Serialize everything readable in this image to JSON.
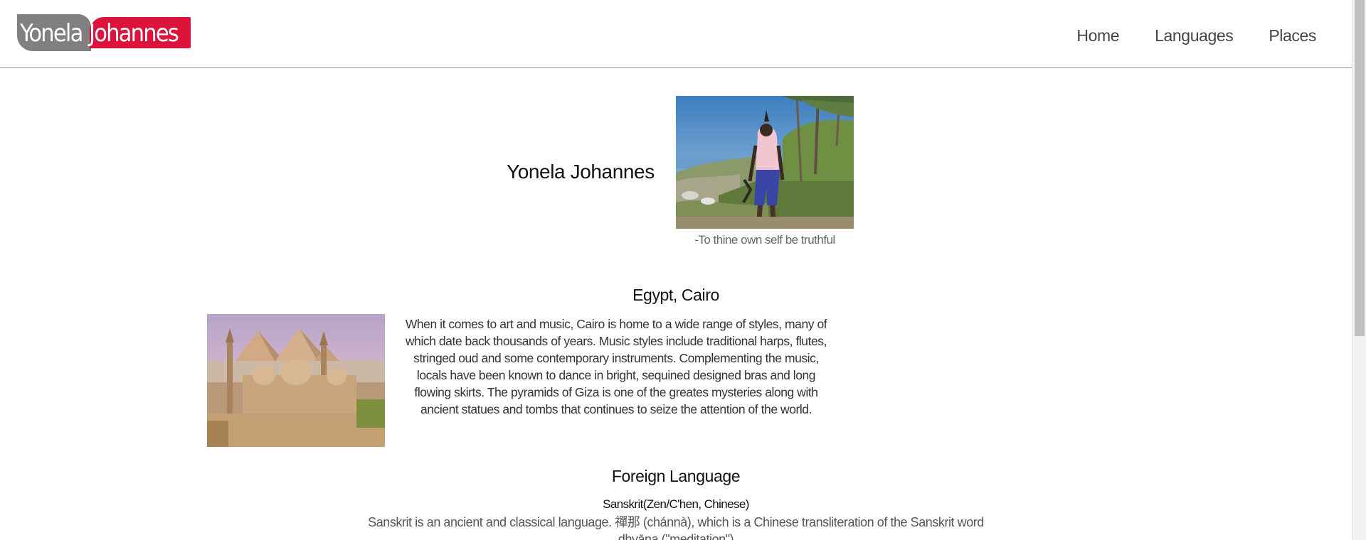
{
  "header": {
    "logo": {
      "part1": "Yonela",
      "part2": "Johannes"
    },
    "nav": [
      {
        "label": "Home"
      },
      {
        "label": "Languages"
      },
      {
        "label": "Places"
      }
    ]
  },
  "hero": {
    "name": "Yonela Johannes",
    "caption": "-To thine own self be truthful"
  },
  "egypt": {
    "title": "Egypt, Cairo",
    "text": "When it comes to art and music, Cairo is home to a wide range of styles, many of which date back thousands of years. Music styles include traditional harps, flutes, stringed oud and some contemporary instruments. Complementing the music, locals have been known to dance in bright, sequined designed bras and long flowing skirts. The pyramids of Giza is one of the greates mysteries along with ancient statues and tombs that continues to seize the attention of the world."
  },
  "languages": {
    "title": "Foreign Language",
    "subtitle": "Sanskrit(Zen/C'hen, Chinese)",
    "text": "Sanskrit is an ancient and classical language. 禪那 (chánnà), which is a Chinese transliteration of the Sanskrit word dhyāna (\"meditation\")"
  }
}
